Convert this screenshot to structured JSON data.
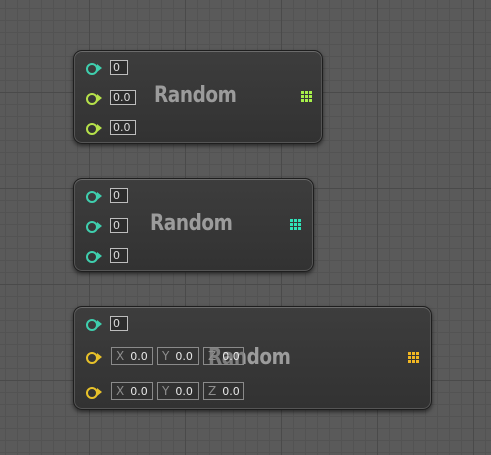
{
  "colors": {
    "int_pin": "#3fcfae",
    "float_pin": "#b6e24a",
    "vector_pin": "#e8c22a",
    "float_icon": "#a7f04a",
    "int_icon": "#2fe2b8",
    "vector_icon": "#f2b722"
  },
  "nodes": [
    {
      "title": "Random",
      "icon": "grid-icon",
      "inputs": [
        {
          "type": "int",
          "value": "0"
        },
        {
          "type": "float",
          "value": "0.0"
        },
        {
          "type": "float",
          "value": "0.0"
        }
      ]
    },
    {
      "title": "Random",
      "icon": "grid-icon",
      "inputs": [
        {
          "type": "int",
          "value": "0"
        },
        {
          "type": "int",
          "value": "0"
        },
        {
          "type": "int",
          "value": "0"
        }
      ]
    },
    {
      "title": "Random",
      "icon": "grid-icon",
      "inputs": [
        {
          "type": "int",
          "value": "0"
        },
        {
          "type": "vector",
          "x_label": "X",
          "x": "0.0",
          "y_label": "Y",
          "y": "0.0",
          "z_label": "Z",
          "z": "0.0"
        },
        {
          "type": "vector",
          "x_label": "X",
          "x": "0.0",
          "y_label": "Y",
          "y": "0.0",
          "z_label": "Z",
          "z": "0.0"
        }
      ]
    }
  ]
}
